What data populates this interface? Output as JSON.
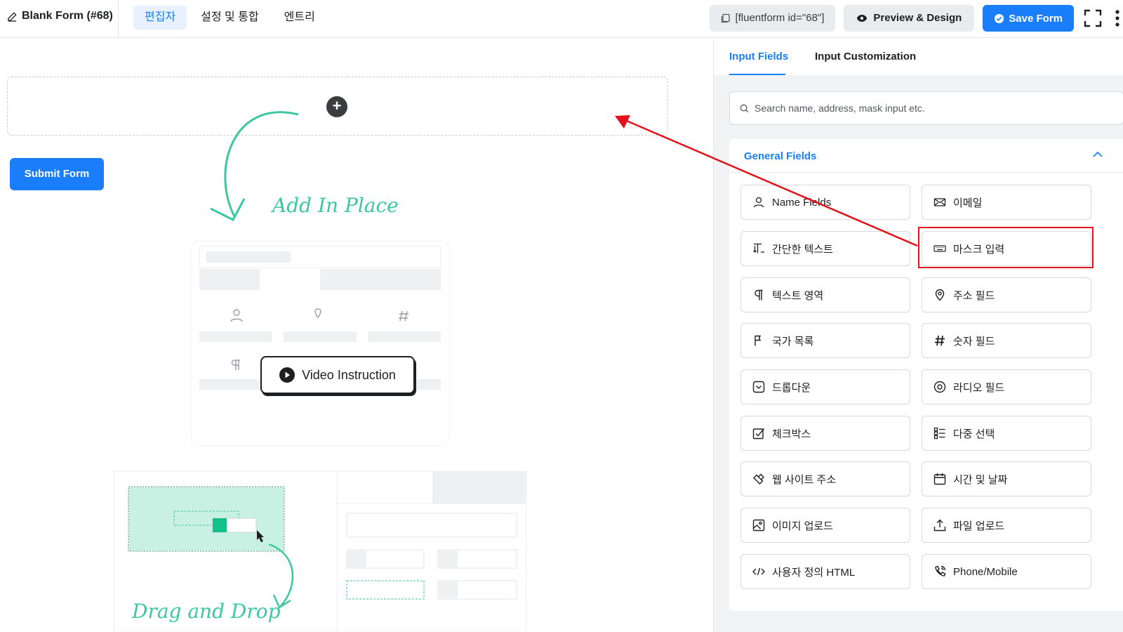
{
  "header": {
    "form_title": "Blank Form (#68)",
    "tabs": [
      {
        "label": "편집자",
        "active": true
      },
      {
        "label": "설정 및 통합",
        "active": false
      },
      {
        "label": "엔트리",
        "active": false
      }
    ],
    "shortcode": "[fluentform id=\"68\"]",
    "preview_label": "Preview & Design",
    "save_label": "Save Form"
  },
  "canvas": {
    "submit_label": "Submit Form",
    "add_in_place": "Add In Place",
    "video_instruction": "Video Instruction",
    "drag_and_drop": "Drag and Drop"
  },
  "panel": {
    "tabs": [
      {
        "label": "Input Fields",
        "active": true
      },
      {
        "label": "Input Customization",
        "active": false
      }
    ],
    "search_placeholder": "Search name, address, mask input etc.",
    "group_title": "General Fields",
    "fields": [
      {
        "label": "Name Fields",
        "icon": "person-icon"
      },
      {
        "label": "이메일",
        "icon": "envelope-icon"
      },
      {
        "label": "간단한 텍스트",
        "icon": "text-icon"
      },
      {
        "label": "마스크 입력",
        "icon": "keyboard-icon"
      },
      {
        "label": "텍스트 영역",
        "icon": "paragraph-icon"
      },
      {
        "label": "주소 필드",
        "icon": "map-pin-icon"
      },
      {
        "label": "국가 목록",
        "icon": "flag-icon"
      },
      {
        "label": "숫자 필드",
        "icon": "hash-icon"
      },
      {
        "label": "드롭다운",
        "icon": "dropdown-icon"
      },
      {
        "label": "라디오 필드",
        "icon": "radio-icon"
      },
      {
        "label": "체크박스",
        "icon": "checkbox-icon"
      },
      {
        "label": "다중 선택",
        "icon": "multi-select-icon"
      },
      {
        "label": "웹 사이트 주소",
        "icon": "link-icon"
      },
      {
        "label": "시간 및 날짜",
        "icon": "calendar-icon"
      },
      {
        "label": "이미지 업로드",
        "icon": "image-icon"
      },
      {
        "label": "파일 업로드",
        "icon": "upload-icon"
      },
      {
        "label": "사용자 정의 HTML",
        "icon": "code-icon"
      },
      {
        "label": "Phone/Mobile",
        "icon": "phone-icon"
      }
    ]
  },
  "colors": {
    "accent": "#1a7efb",
    "highlight": "#e3121b",
    "illustration": "#3cc7a1"
  }
}
